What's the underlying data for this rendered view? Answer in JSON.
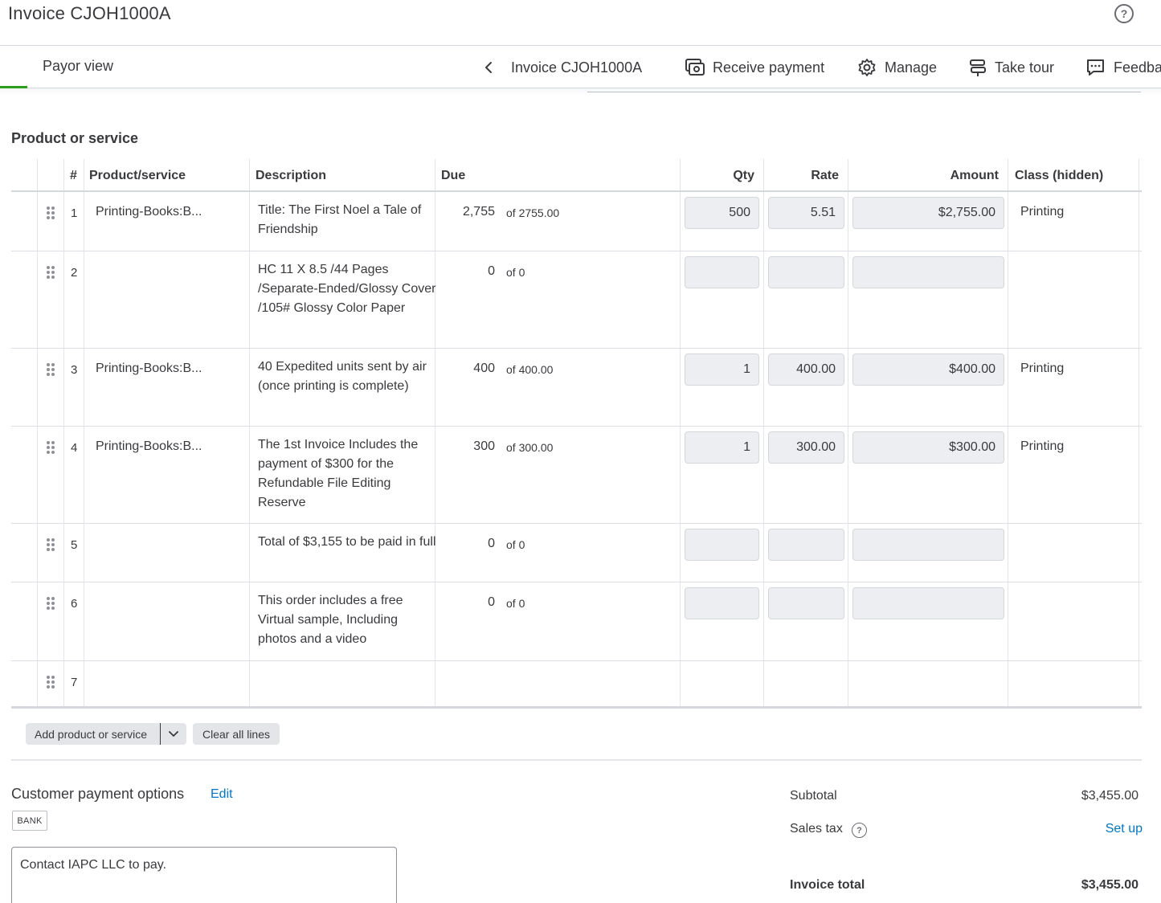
{
  "header": {
    "title": "Invoice CJOH1000A",
    "help_icon": "question-circle-icon"
  },
  "toolbar": {
    "payor_view": "Payor view",
    "invoice_nav": "Invoice CJOH1000A",
    "receive_payment": "Receive payment",
    "manage": "Manage",
    "take_tour": "Take tour",
    "feedback": "Feedba",
    "accent_color": "#2ca01c"
  },
  "section": {
    "title": "Product or service"
  },
  "table": {
    "headers": {
      "num": "#",
      "product": "Product/service",
      "description": "Description",
      "due": "Due",
      "qty": "Qty",
      "rate": "Rate",
      "amount": "Amount",
      "class": "Class (hidden)"
    },
    "rows": [
      {
        "num": "1",
        "product": "Printing-Books:B...",
        "description": "Title: The First Noel a Tale of Friendship",
        "due": "2,755",
        "due_of": "of 2755.00",
        "qty": "500",
        "rate": "5.51",
        "amount": "$2,755.00",
        "class": "Printing"
      },
      {
        "num": "2",
        "product": "",
        "description": "HC 11 X 8.5 /44 Pages /Separate-Ended/Glossy Cover /105#  Glossy Color Paper",
        "due": "0",
        "due_of": "of 0",
        "qty": "",
        "rate": "",
        "amount": "",
        "class": ""
      },
      {
        "num": "3",
        "product": "Printing-Books:B...",
        "description": "40 Expedited units sent by air (once printing is complete)",
        "due": "400",
        "due_of": "of 400.00",
        "qty": "1",
        "rate": "400.00",
        "amount": "$400.00",
        "class": "Printing"
      },
      {
        "num": "4",
        "product": "Printing-Books:B...",
        "description": "The 1st Invoice Includes the payment of $300 for the Refundable File Editing Reserve",
        "due": "300",
        "due_of": "of 300.00",
        "qty": "1",
        "rate": "300.00",
        "amount": "$300.00",
        "class": "Printing"
      },
      {
        "num": "5",
        "product": "",
        "description": "Total of $3,155  to be paid in full",
        "due": "0",
        "due_of": "of 0",
        "qty": "",
        "rate": "",
        "amount": "",
        "class": ""
      },
      {
        "num": "6",
        "product": "",
        "description": "This order includes a free Virtual sample, Including photos and a video",
        "due": "0",
        "due_of": "of 0",
        "qty": "",
        "rate": "",
        "amount": "",
        "class": ""
      },
      {
        "num": "7",
        "product": "",
        "description": "",
        "due": "",
        "due_of": "",
        "qty": "",
        "rate": "",
        "amount": "",
        "class": ""
      }
    ]
  },
  "actions": {
    "add_product": "Add product or service",
    "clear_all": "Clear all lines"
  },
  "payment_options": {
    "title": "Customer payment options",
    "edit": "Edit",
    "bank_badge": "BANK",
    "memo": "Contact IAPC LLC to pay."
  },
  "totals": {
    "subtotal_label": "Subtotal",
    "subtotal_value": "$3,455.00",
    "sales_tax_label": "Sales tax",
    "sales_tax_action": "Set up",
    "invoice_total_label": "Invoice total",
    "invoice_total_value": "$3,455.00",
    "link_color": "#0077c5"
  }
}
